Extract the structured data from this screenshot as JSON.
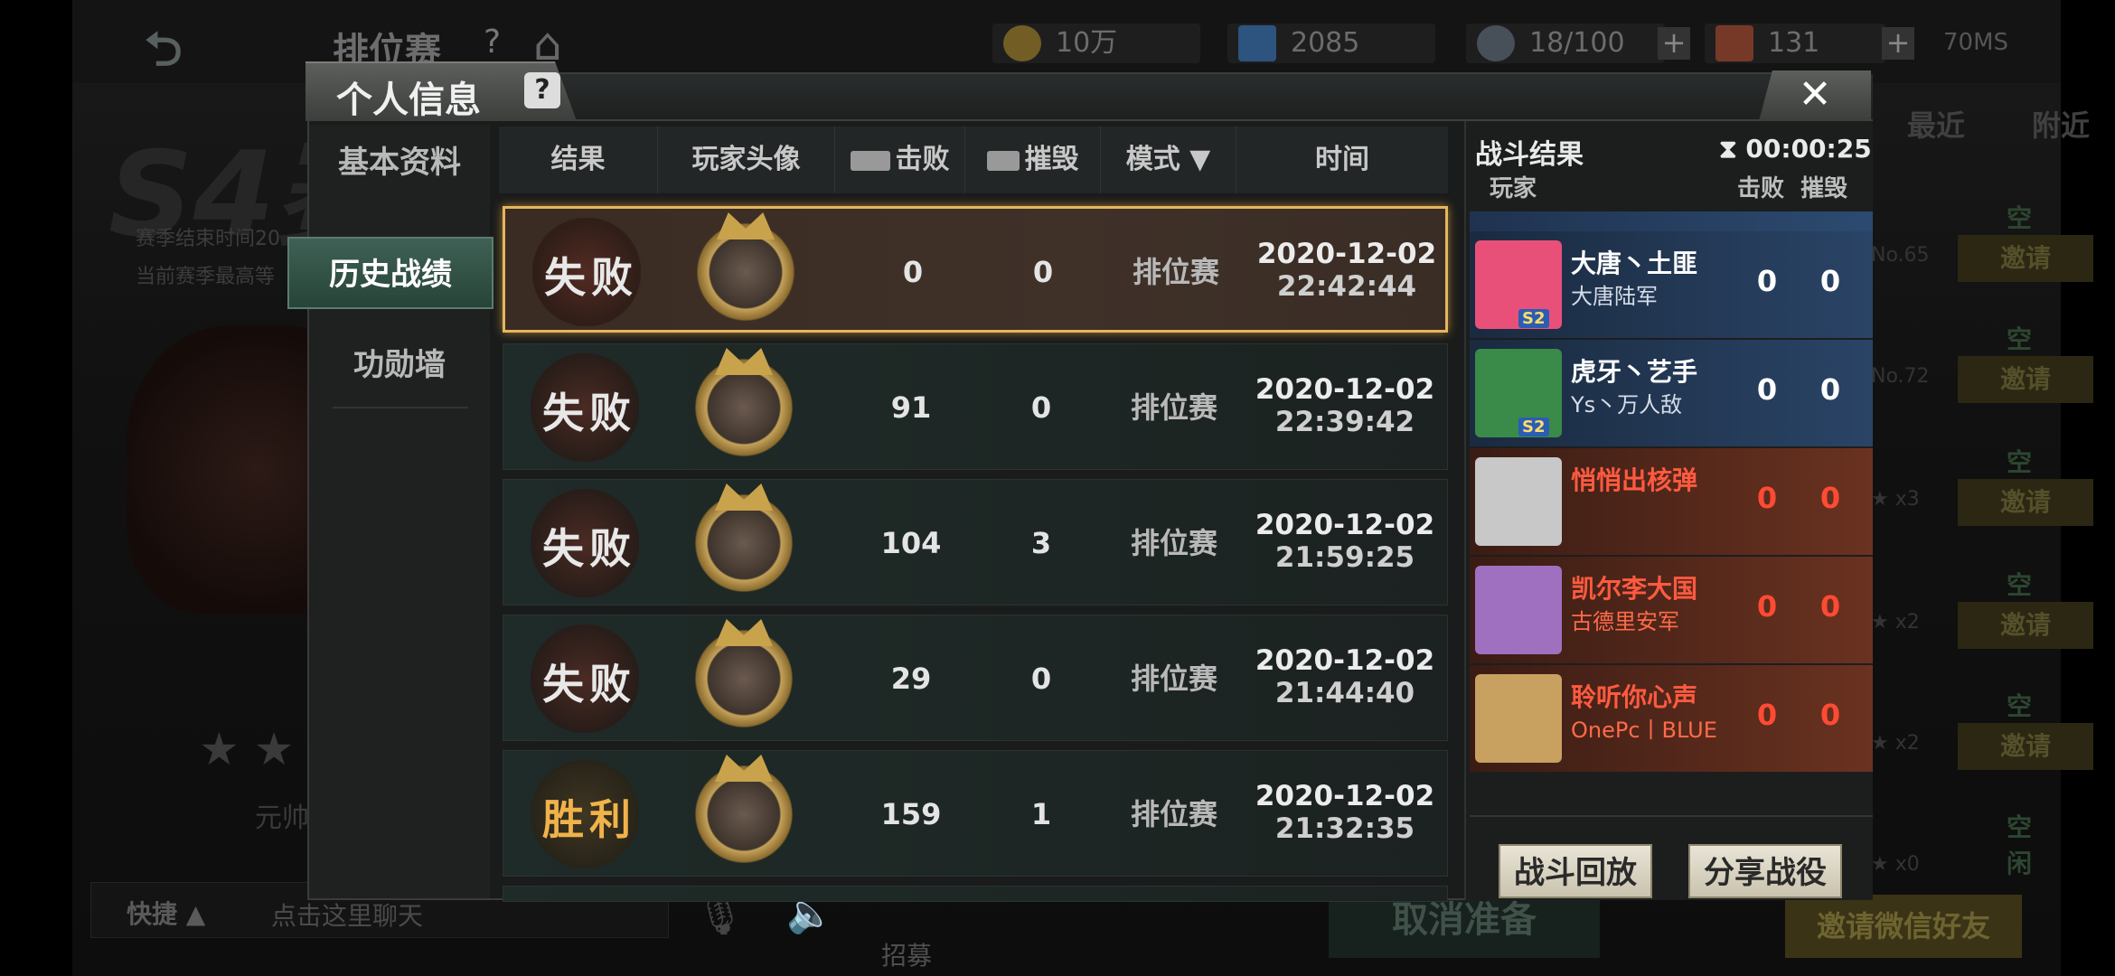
{
  "topbar": {
    "mode_title": "排位赛",
    "help": "?",
    "resources": [
      {
        "value": "10万",
        "color": "#b8932a"
      },
      {
        "value": "2085",
        "color": "#3a7fd0"
      },
      {
        "value": "18/100",
        "color": "#6a7a8a"
      },
      {
        "value": "131",
        "color": "#c05030"
      }
    ],
    "plus": "+",
    "latency": "70MS"
  },
  "background": {
    "season_logo": "S4赛",
    "season_line1": "赛季结束时间20",
    "season_line2": "当前赛季最高等",
    "stars": "★ ★",
    "yuan": "元帅",
    "chat_quick": "快捷 ▲",
    "chat_placeholder": "点击这里聊天",
    "recruit": "招募",
    "cancel_ready": "取消准备",
    "invite_wechat": "邀请微信好友",
    "right_tabs": [
      "最近",
      "附近"
    ],
    "slots": [
      {
        "idle": "空闲",
        "invite": "邀请",
        "no": "No.65"
      },
      {
        "idle": "空闲",
        "invite": "邀请",
        "no": "No.72"
      },
      {
        "idle": "空闲",
        "invite": "邀请",
        "no": "★ x3"
      },
      {
        "idle": "空闲",
        "invite": "邀请",
        "no": "★ x2"
      },
      {
        "idle": "空闲",
        "invite": "邀请",
        "no": "★ x2"
      },
      {
        "idle": "空闲",
        "invite": "邀请",
        "no": "★ x0"
      }
    ]
  },
  "dialog": {
    "title": "个人信息",
    "help": "?",
    "close": "✕",
    "nav": [
      {
        "label": "基本资料"
      },
      {
        "label": "历史战绩"
      },
      {
        "label": "功勋墙"
      }
    ],
    "headers": {
      "result": "结果",
      "avatar": "玩家头像",
      "kills": "击败",
      "destroy": "摧毁",
      "mode": "模式 ▼",
      "time": "时间"
    },
    "rows": [
      {
        "result": "失败",
        "win": false,
        "kills": "0",
        "destroy": "0",
        "mode": "排位赛",
        "date": "2020-12-02",
        "time": "22:42:44",
        "selected": true
      },
      {
        "result": "失败",
        "win": false,
        "kills": "91",
        "destroy": "0",
        "mode": "排位赛",
        "date": "2020-12-02",
        "time": "22:39:42",
        "selected": false
      },
      {
        "result": "失败",
        "win": false,
        "kills": "104",
        "destroy": "3",
        "mode": "排位赛",
        "date": "2020-12-02",
        "time": "21:59:25",
        "selected": false
      },
      {
        "result": "失败",
        "win": false,
        "kills": "29",
        "destroy": "0",
        "mode": "排位赛",
        "date": "2020-12-02",
        "time": "21:44:40",
        "selected": false
      },
      {
        "result": "胜利",
        "win": true,
        "kills": "159",
        "destroy": "1",
        "mode": "排位赛",
        "date": "2020-12-02",
        "time": "21:32:35",
        "selected": false
      }
    ],
    "battle": {
      "title": "战斗结果",
      "timer": "⧗ 00:00:25",
      "col_player": "玩家",
      "col_kills": "击败",
      "col_destroy": "摧毁",
      "players": [
        {
          "team": "blue",
          "name": "大唐丶土匪",
          "clan": "大唐陆军",
          "kills": "0",
          "destroy": "0",
          "rank": "S2",
          "avatar_color": "#e8507a"
        },
        {
          "team": "blue",
          "name": "虎牙丶艺手",
          "clan": "Ys丶万人敌",
          "kills": "0",
          "destroy": "0",
          "rank": "S2",
          "avatar_color": "#3a8a4a"
        },
        {
          "team": "red",
          "name": "悄悄出核弹",
          "clan": "",
          "kills": "0",
          "destroy": "0",
          "rank": "",
          "avatar_color": "#c8c8c8"
        },
        {
          "team": "red",
          "name": "凯尔李大国",
          "clan": "古德里安军",
          "kills": "0",
          "destroy": "0",
          "rank": "",
          "avatar_color": "#a070c0"
        },
        {
          "team": "red",
          "name": "聆听你心声",
          "clan": "OnePc丨BLUE",
          "kills": "0",
          "destroy": "0",
          "rank": "",
          "avatar_color": "#c8a060"
        }
      ],
      "replay_button": "战斗回放",
      "share_button": "分享战役"
    }
  }
}
